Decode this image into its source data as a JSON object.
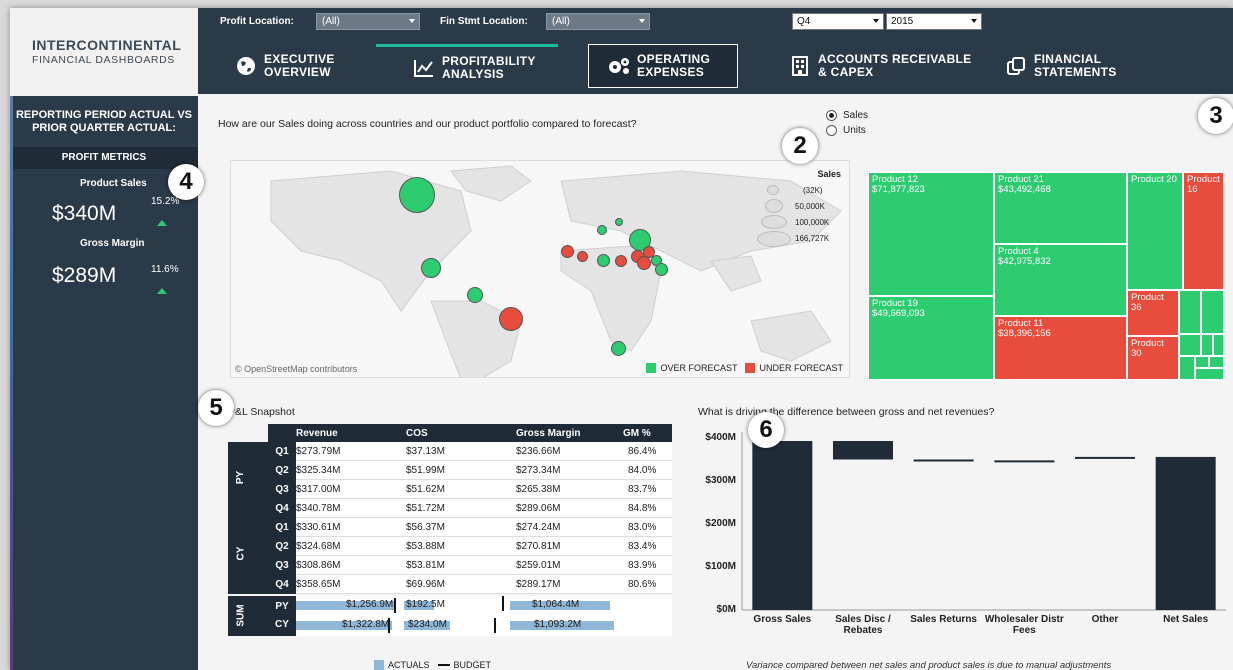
{
  "brand": {
    "line1": "INTERCONTINENTAL",
    "line2": "FINANCIAL DASHBOARDS"
  },
  "sidebar": {
    "report_title": "REPORTING PERIOD ACTUAL VS PRIOR QUARTER ACTUAL:",
    "metrics_header": "PROFIT METRICS",
    "product_sales": {
      "label": "Product Sales",
      "value": "$340M",
      "change": "15.2%"
    },
    "gross_margin": {
      "label": "Gross Margin",
      "value": "$289M",
      "change": "11.6%"
    }
  },
  "filters": {
    "profit_location": {
      "label": "Profit Location:",
      "value": "(All)"
    },
    "fin_stmt_location": {
      "label": "Fin Stmt Location:",
      "value": "(All)"
    },
    "quarter": "Q4",
    "year": "2015"
  },
  "nav": {
    "tabs": [
      {
        "line1": "EXECUTIVE",
        "line2": "OVERVIEW",
        "icon": "globe-icon"
      },
      {
        "line1": "PROFITABILITY",
        "line2": "ANALYSIS",
        "icon": "line-chart-icon"
      },
      {
        "line1": "OPERATING",
        "line2": "EXPENSES",
        "icon": "gears-icon"
      },
      {
        "line1": "ACCOUNTS RECEIVABLE",
        "line2": "& CAPEX",
        "icon": "building-icon"
      },
      {
        "line1": "FINANCIAL",
        "line2": "STATEMENTS",
        "icon": "copy-icon"
      }
    ]
  },
  "main": {
    "question": "How are our Sales doing across countries and our product portfolio compared to forecast?",
    "radio": {
      "sales": "Sales",
      "units": "Units",
      "selected": "Sales"
    },
    "map": {
      "attribution": "© OpenStreetMap contributors",
      "legend_over": "OVER FORECAST",
      "legend_under": "UNDER FORECAST",
      "size_legend": {
        "title": "Sales",
        "items": [
          "(32K)",
          "50,000K",
          "100,000K",
          "166,727K"
        ]
      },
      "colors": {
        "over": "#2ecc71",
        "under": "#e74c3c"
      }
    },
    "treemap": [
      {
        "name": "Product 12",
        "value": "$71,877,823",
        "status": "over"
      },
      {
        "name": "Product 21",
        "value": "$43,492,468",
        "status": "over"
      },
      {
        "name": "Product 20",
        "value": "",
        "status": "over"
      },
      {
        "name": "Product 16",
        "value": "",
        "status": "under"
      },
      {
        "name": "Product 4",
        "value": "$42,975,832",
        "status": "over"
      },
      {
        "name": "Product 19",
        "value": "$49,669,093",
        "status": "over"
      },
      {
        "name": "Product 11",
        "value": "$38,396,156",
        "status": "under"
      },
      {
        "name": "Product 36",
        "value": "",
        "status": "under"
      },
      {
        "name": "Product 30",
        "value": "",
        "status": "under"
      }
    ],
    "badges": [
      "2",
      "3",
      "4",
      "5",
      "6"
    ]
  },
  "pl": {
    "title": "P&L Snapshot",
    "columns": [
      "Revenue",
      "COS",
      "Gross Margin",
      "GM %"
    ],
    "groups": [
      "PY",
      "CY",
      "SUM"
    ],
    "rows": [
      {
        "q": "Q1",
        "rev": "$273.79M",
        "cos": "$37.13M",
        "gm": "$236.66M",
        "pct": "86.4%"
      },
      {
        "q": "Q2",
        "rev": "$325.34M",
        "cos": "$51.99M",
        "gm": "$273.34M",
        "pct": "84.0%"
      },
      {
        "q": "Q3",
        "rev": "$317.00M",
        "cos": "$51.62M",
        "gm": "$265.38M",
        "pct": "83.7%"
      },
      {
        "q": "Q4",
        "rev": "$340.78M",
        "cos": "$51.72M",
        "gm": "$289.06M",
        "pct": "84.8%"
      },
      {
        "q": "Q1",
        "rev": "$330.61M",
        "cos": "$56.37M",
        "gm": "$274.24M",
        "pct": "83.0%"
      },
      {
        "q": "Q2",
        "rev": "$324.68M",
        "cos": "$53.88M",
        "gm": "$270.81M",
        "pct": "83.4%"
      },
      {
        "q": "Q3",
        "rev": "$308.86M",
        "cos": "$53.81M",
        "gm": "$259.01M",
        "pct": "83.9%"
      },
      {
        "q": "Q4",
        "rev": "$358.65M",
        "cos": "$69.96M",
        "gm": "$289.17M",
        "pct": "80.6%"
      }
    ],
    "sum": [
      {
        "label": "PY",
        "rev": "$1,256.9M",
        "cos": "$192.5M",
        "gm": "$1,064.4M"
      },
      {
        "label": "CY",
        "rev": "$1,322.8M",
        "cos": "$234.0M",
        "gm": "$1,093.2M"
      }
    ],
    "legend_actuals": "ACTUALS",
    "legend_budget": "BUDGET"
  },
  "chart_data": {
    "type": "bar",
    "title": "What is driving the difference between gross and net revenues?",
    "categories": [
      "Gross Sales",
      "Sales Disc / Rebates",
      "Sales Returns",
      "Wholesaler Distr Fees",
      "Other",
      "Net Sales"
    ],
    "waterfall": [
      {
        "label": "Gross Sales",
        "start": 0,
        "end": 393
      },
      {
        "label": "Sales Disc / Rebates",
        "start": 393,
        "end": 350
      },
      {
        "label": "Sales Returns",
        "start": 350,
        "end": 348
      },
      {
        "label": "Wholesaler Distr Fees",
        "start": 348,
        "end": 346
      },
      {
        "label": "Other",
        "start": 356,
        "end": 352
      },
      {
        "label": "Net Sales",
        "start": 0,
        "end": 356
      }
    ],
    "yticks": [
      "$0M",
      "$100M",
      "$200M",
      "$300M",
      "$400M"
    ],
    "ylim": [
      0,
      400
    ],
    "note": "Variance compared between net sales and product sales is due to manual adjustments"
  }
}
